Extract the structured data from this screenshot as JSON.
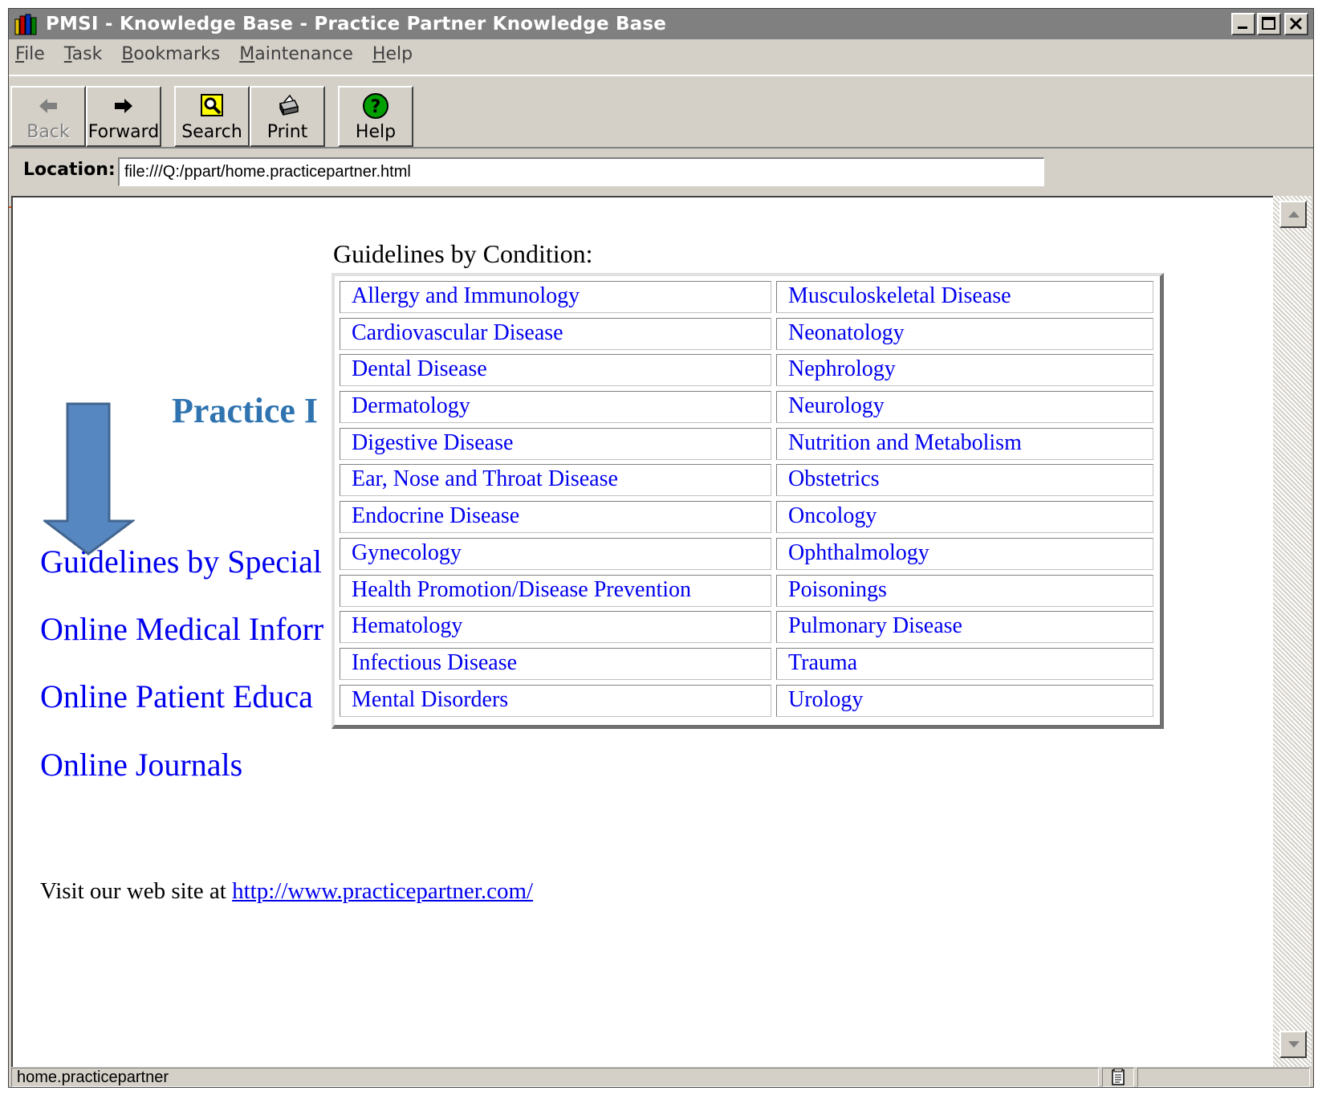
{
  "window": {
    "title": "PMSI - Knowledge Base - Practice Partner Knowledge Base"
  },
  "menu": [
    "File",
    "Task",
    "Bookmarks",
    "Maintenance",
    "Help"
  ],
  "menu_hotkeys": [
    "F",
    "T",
    "B",
    "M",
    "H"
  ],
  "toolbar": {
    "back": "Back",
    "forward": "Forward",
    "search": "Search",
    "print": "Print",
    "help": "Help"
  },
  "location": {
    "label": "Location:",
    "value": "file:///Q:/ppart/home.practicepartner.html"
  },
  "page": {
    "heading_partial": "Practice I",
    "links": [
      "Guidelines by Special",
      "Online Medical Inforr",
      "Online Patient Educa",
      "Online Journals"
    ],
    "visit_text": "Visit our web site at ",
    "visit_link": "http://www.practicepartner.com/"
  },
  "conditions": {
    "title": "Guidelines by Condition:",
    "left": [
      "Allergy and Immunology",
      "Cardiovascular Disease",
      "Dental Disease",
      "Dermatology",
      "Digestive Disease",
      "Ear, Nose and Throat Disease",
      "Endocrine Disease",
      "Gynecology",
      "Health Promotion/Disease Prevention",
      "Hematology",
      "Infectious Disease",
      "Mental Disorders"
    ],
    "right": [
      "Musculoskeletal Disease",
      "Neonatology",
      "Nephrology",
      "Neurology",
      "Nutrition and Metabolism",
      "Obstetrics",
      "Oncology",
      "Ophthalmology",
      "Poisonings",
      "Pulmonary Disease",
      "Trauma",
      "Urology"
    ]
  },
  "status": {
    "text": "home.practicepartner"
  },
  "colors": {
    "arrow_fill": "#4f81bd",
    "arrow_stroke": "#385d8a",
    "heading": "#2f74b0",
    "link": "#0000ee"
  }
}
